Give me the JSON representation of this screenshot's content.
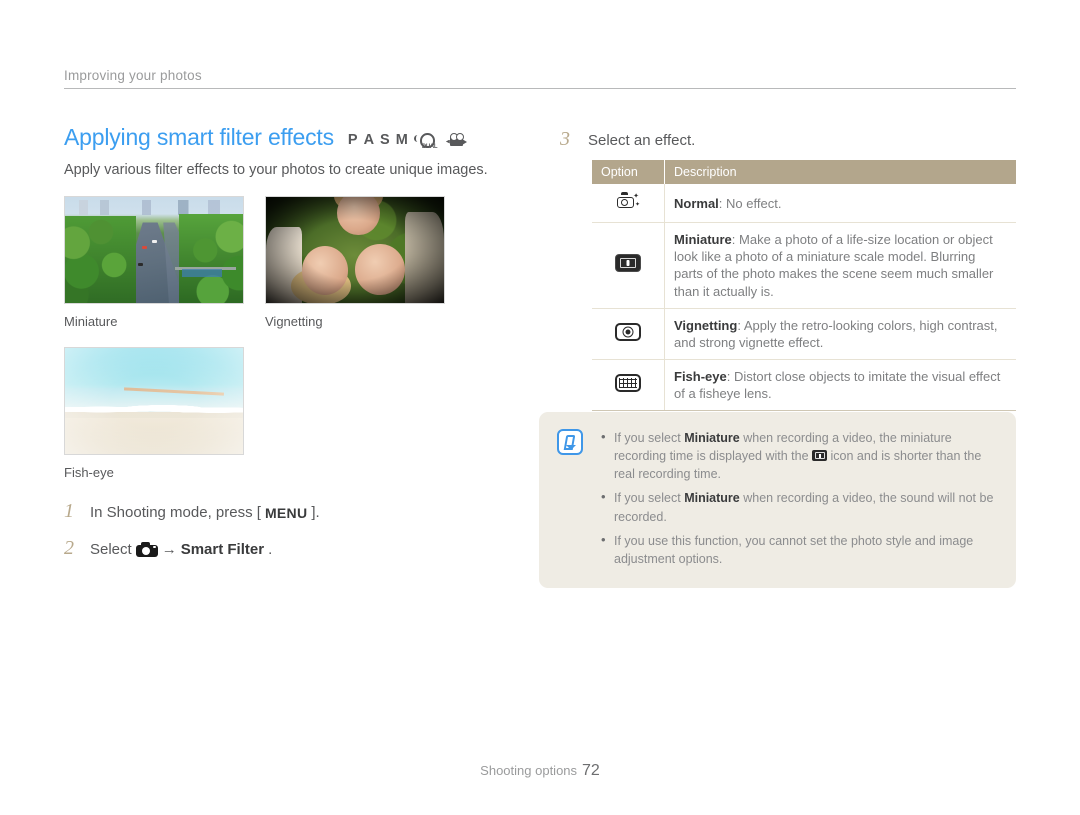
{
  "running_head": "Improving your photos",
  "section": {
    "title": "Applying smart filter effects",
    "mode_icons": [
      "P",
      "A",
      "S",
      "M",
      "dual-is-icon",
      "movie-icon"
    ],
    "mode_letters": {
      "p": "P",
      "a": "A",
      "s": "S",
      "m": "M"
    },
    "dual_label": "DUAL",
    "subtitle": "Apply various filter effects to your photos to create unique images."
  },
  "samples": [
    {
      "caption": "Miniature",
      "alt": "aerial-highway-photo"
    },
    {
      "caption": "Vignetting",
      "alt": "three-faces-on-grass-photo"
    },
    {
      "caption": "Fish-eye",
      "alt": "family-running-on-beach-photo"
    }
  ],
  "steps": [
    {
      "number": "1",
      "prefix": "In Shooting mode, press [",
      "key": "MENU",
      "suffix": "]."
    },
    {
      "number": "2",
      "prefix": "Select",
      "icon": "camera-icon",
      "arrow": "→",
      "target": "Smart Filter",
      "suffix": "."
    }
  ],
  "step3": {
    "number": "3",
    "text": "Select an effect."
  },
  "table": {
    "headers": {
      "option": "Option",
      "description": "Description"
    },
    "rows": [
      {
        "icon": "normal-camera-icon",
        "name": "Normal",
        "separator": ":",
        "description": "No effect."
      },
      {
        "icon": "miniature-icon",
        "name": "Miniature",
        "separator": ":",
        "description": "Make a photo of a life-size location or object look like a photo of a miniature scale model. Blurring parts of the photo makes the scene seem much smaller than it actually is."
      },
      {
        "icon": "vignetting-icon",
        "name": "Vignetting",
        "separator": ":",
        "description": "Apply the retro-looking colors, high contrast, and strong vignette effect."
      },
      {
        "icon": "fisheye-icon",
        "name": "Fish-eye",
        "separator": ":",
        "description": "Distort close objects to imitate the visual effect of a fisheye lens."
      }
    ]
  },
  "note": {
    "icon": "note-pen-icon",
    "items": [
      {
        "part1": "If you select",
        "strong1": "Miniature",
        "part2": "when recording a video, the miniature recording time is displayed with the",
        "inline_icon": "miniature-icon",
        "part3": "icon and is shorter than the real recording time."
      },
      {
        "part1": "If you select",
        "strong1": "Miniature",
        "part2": "when recording a video, the sound will not be recorded.",
        "inline_icon": null,
        "part3": ""
      },
      {
        "part1": "If you use this function, you cannot set the photo style and image adjustment options.",
        "strong1": "",
        "part2": "",
        "inline_icon": null,
        "part3": ""
      }
    ]
  },
  "footer": {
    "label": "Shooting options",
    "page": "72"
  },
  "colors": {
    "title_blue": "#3c9ef0",
    "table_header_tan": "#b3a68c",
    "note_bg": "#efece4",
    "step_num": "#b8a98c",
    "body_text": "#58595b"
  }
}
